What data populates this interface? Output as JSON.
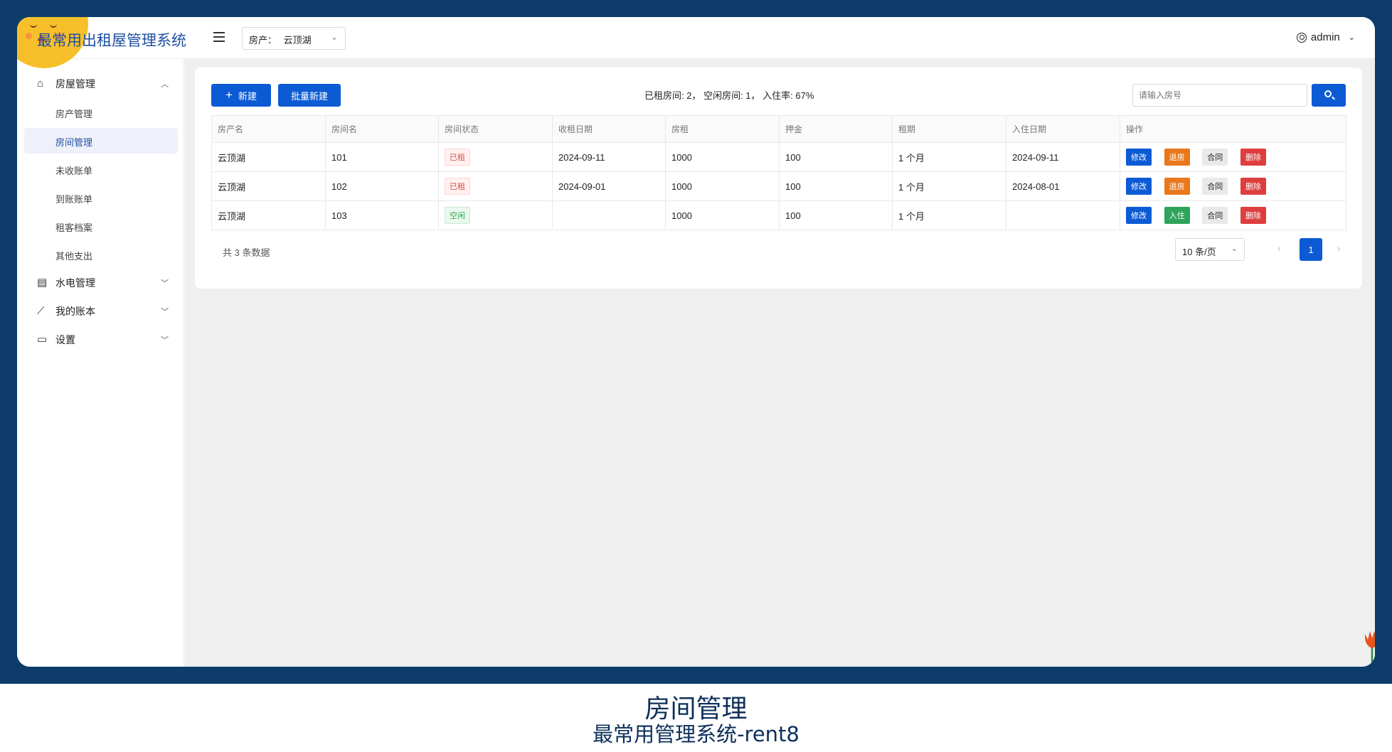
{
  "app": {
    "title": "最常用出租屋管理系统"
  },
  "header": {
    "property_label": "房产：",
    "property_value": "云顶湖",
    "user": "admin"
  },
  "sidebar": {
    "groups": [
      {
        "label": "房屋管理",
        "icon": "home-icon",
        "expanded": true
      },
      {
        "label": "水电管理",
        "icon": "meter-icon",
        "expanded": false
      },
      {
        "label": "我的账本",
        "icon": "chart-icon",
        "expanded": false
      },
      {
        "label": "设置",
        "icon": "settings-monitor-icon",
        "expanded": false
      }
    ],
    "items": [
      {
        "label": "房产管理"
      },
      {
        "label": "房间管理",
        "active": true
      },
      {
        "label": "未收账单"
      },
      {
        "label": "到账账单"
      },
      {
        "label": "租客档案"
      },
      {
        "label": "其他支出"
      }
    ]
  },
  "toolbar": {
    "new_label": "新建",
    "batch_label": "批量新建",
    "stats": "已租房间: 2， 空闲房间: 1， 入住率: 67%",
    "search_placeholder": "请输入房号"
  },
  "table": {
    "columns": [
      "房产名",
      "房间名",
      "房间状态",
      "收租日期",
      "房租",
      "押金",
      "租期",
      "入住日期",
      "操作"
    ],
    "rows": [
      {
        "property": "云顶湖",
        "room": "101",
        "status": "已租",
        "rent_date": "2024-09-11",
        "rent": "1000",
        "deposit": "100",
        "term": "1 个月",
        "checkin": "2024-09-11",
        "action2": "退房"
      },
      {
        "property": "云顶湖",
        "room": "102",
        "status": "已租",
        "rent_date": "2024-09-01",
        "rent": "1000",
        "deposit": "100",
        "term": "1 个月",
        "checkin": "2024-08-01",
        "action2": "退房"
      },
      {
        "property": "云顶湖",
        "room": "103",
        "status": "空闲",
        "rent_date": "",
        "rent": "1000",
        "deposit": "100",
        "term": "1 个月",
        "checkin": "",
        "action2": "入住"
      }
    ],
    "actions": {
      "edit": "修改",
      "contract": "合同",
      "delete": "删除"
    }
  },
  "pagination": {
    "total": "共 3 条数据",
    "page_size": "10 条/页",
    "current": "1"
  },
  "caption": {
    "title": "房间管理",
    "subtitle": "最常用管理系统-rent8"
  },
  "colors": {
    "frame": "#0d3c6b",
    "primary": "#0c5bd4",
    "danger": "#de3e3e",
    "warning": "#e9781c",
    "success": "#2ea45a"
  }
}
